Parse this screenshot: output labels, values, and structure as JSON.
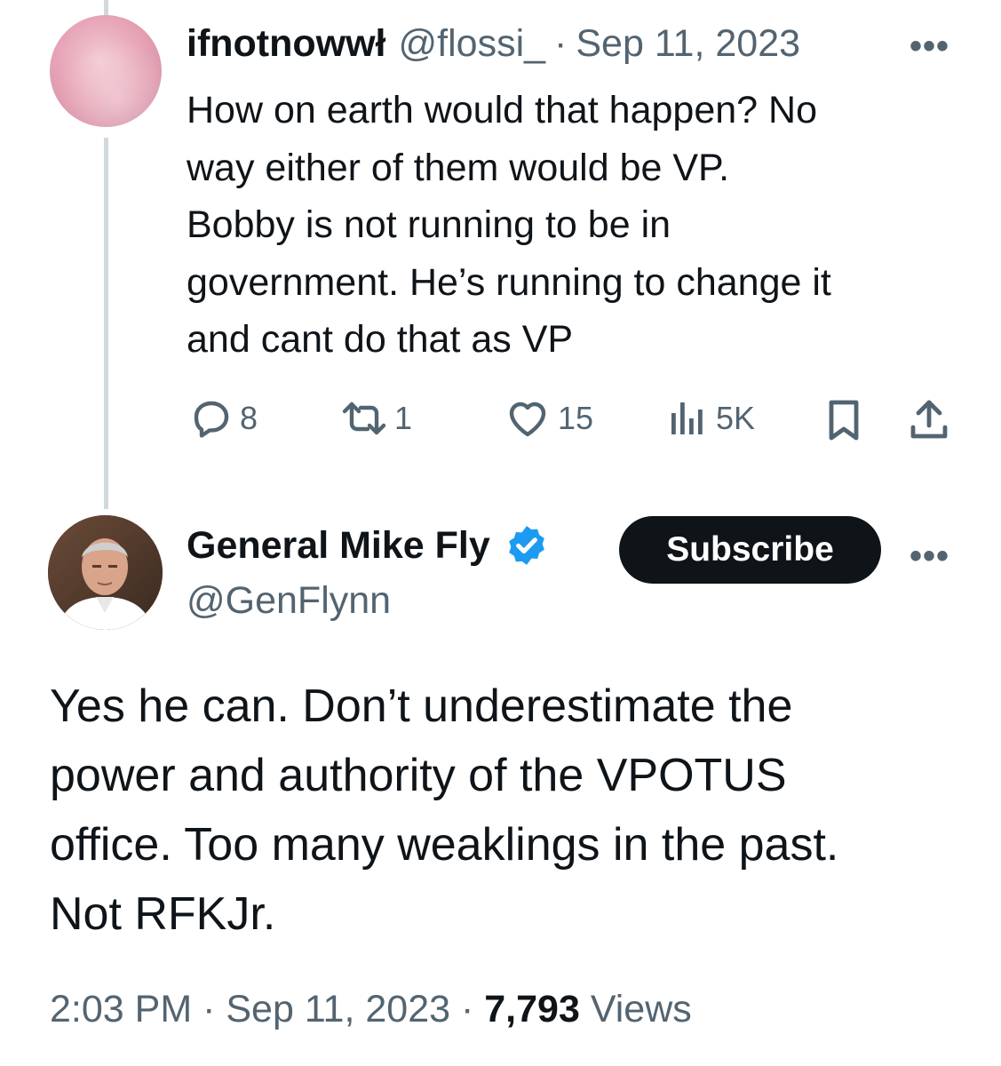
{
  "reply": {
    "display_name": "ifnotnowwł",
    "handle": "@flossi_",
    "separator": "·",
    "date": "Sep 11, 2023",
    "more_icon": "more-horizontal-icon",
    "body": "How on earth would that happen? No\nway either of them would be VP.\nBobby is not running to be in\ngovernment. He’s running to change it\nand cant do that as VP",
    "actions": {
      "replies": "8",
      "reposts": "1",
      "likes": "15",
      "views": "5K"
    }
  },
  "main": {
    "display_name": "General Mike Fly",
    "handle": "@GenFlynn",
    "verified_color": "#1d9bf0",
    "subscribe_label": "Subscribe",
    "body": "Yes he can. Don’t underestimate the\npower and authority of the VPOTUS\noffice. Too many weaklings in the past.\nNot RFKJr.",
    "time": "2:03 PM",
    "date": "Sep 11, 2023",
    "separator": "·",
    "view_count": "7,793",
    "views_label": "Views"
  }
}
